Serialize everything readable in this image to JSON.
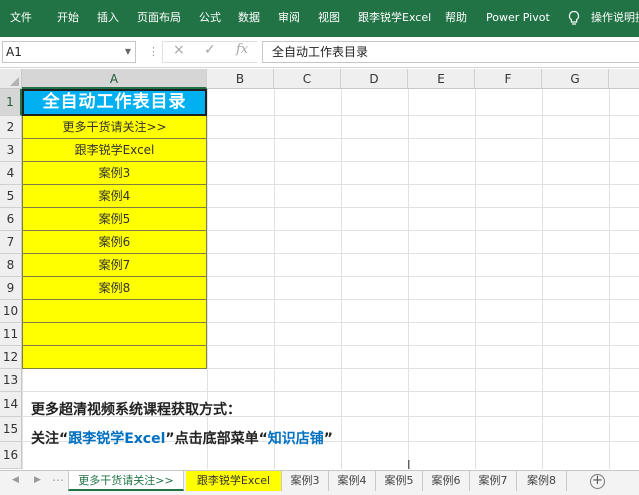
{
  "ribbon": {
    "tabs": [
      "文件",
      "开始",
      "插入",
      "页面布局",
      "公式",
      "数据",
      "审阅",
      "视图",
      "跟李锐学Excel",
      "帮助",
      "Power Pivot"
    ],
    "search_hint": "操作说明搜",
    "search_icon": "lightbulb-icon",
    "bg_color": "#217346"
  },
  "formula_bar": {
    "name_box": "A1",
    "cancel_icon": "×",
    "enter_icon": "✓",
    "fx_label": "fx",
    "formula": "全自动工作表目录"
  },
  "grid": {
    "columns": [
      "A",
      "B",
      "C",
      "D",
      "E",
      "F",
      "G"
    ],
    "rows": [
      "1",
      "2",
      "3",
      "4",
      "5",
      "6",
      "7",
      "8",
      "9",
      "10",
      "11",
      "12",
      "13",
      "14",
      "15",
      "16"
    ],
    "title_cell": "全自动工作表目录",
    "column_a": [
      "更多干货请关注>>",
      "跟李锐学Excel",
      "案例3",
      "案例4",
      "案例5",
      "案例6",
      "案例7",
      "案例8",
      "",
      "",
      ""
    ],
    "note_line1": "更多超清视频系统课程获取方式：",
    "note_line2": {
      "prefix": "关注“",
      "highlight1": "跟李锐学Excel",
      "middle": "”点击底部菜单“",
      "highlight2": "知识店铺",
      "suffix": "”"
    },
    "title_color": "#00b0f0",
    "fill_color": "#ffff00",
    "highlight_color": "#0070c0"
  },
  "sheet_tabs": {
    "tabs": [
      "更多干货请关注>>",
      "跟李锐学Excel",
      "案例3",
      "案例4",
      "案例5",
      "案例6",
      "案例7",
      "案例8"
    ],
    "active": "更多干货请关注>>",
    "add_label": "+"
  }
}
